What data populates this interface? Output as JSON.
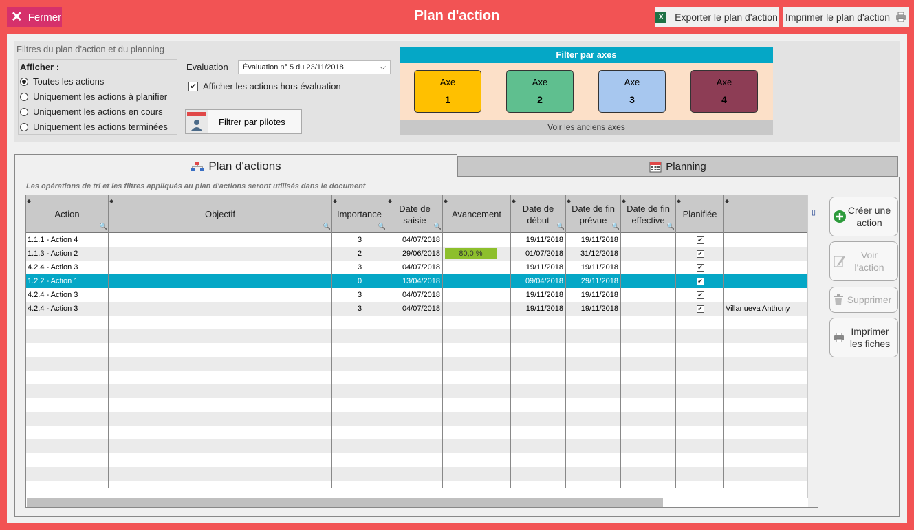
{
  "header": {
    "close_label": "Fermer",
    "title": "Plan d'action",
    "export_label": "Exporter le plan d'action",
    "print_label": "Imprimer le plan d'action"
  },
  "filters": {
    "title": "Filtres du plan d'action et du planning",
    "afficher_label": "Afficher :",
    "options": [
      {
        "label": "Toutes les actions",
        "selected": true
      },
      {
        "label": "Uniquement les actions à planifier",
        "selected": false
      },
      {
        "label": "Uniquement les actions en cours",
        "selected": false
      },
      {
        "label": "Uniquement les actions terminées",
        "selected": false
      }
    ],
    "evaluation_label": "Evaluation",
    "evaluation_value": "Évaluation n° 5 du 23/11/2018",
    "hors_evaluation_label": "Afficher les actions hors évaluation",
    "hors_evaluation_checked": true,
    "pilotes_label": "Filtrer par pilotes"
  },
  "axes": {
    "header": "Filter par axes",
    "footer": "Voir les anciens axes",
    "items": [
      {
        "label": "Axe",
        "number": "1",
        "color": "#ffc000"
      },
      {
        "label": "Axe",
        "number": "2",
        "color": "#5fbf8f"
      },
      {
        "label": "Axe",
        "number": "3",
        "color": "#a7c7ef"
      },
      {
        "label": "Axe",
        "number": "4",
        "color": "#8d3d55"
      }
    ]
  },
  "tabs": {
    "plan": "Plan d'actions",
    "planning": "Planning"
  },
  "note": "Les opérations de tri et les filtres appliqués au plan d'actions seront utilisés dans le document",
  "table": {
    "columns": [
      "Action",
      "Objectif",
      "Importance",
      "Date de saisie",
      "Avancement",
      "Date de début",
      "Date de fin prévue",
      "Date de fin effective",
      "Planifiée",
      ""
    ],
    "rows": [
      {
        "action": "1.1.1 - Action 4",
        "objectif": "",
        "importance": "3",
        "saisie": "04/07/2018",
        "avancement": "",
        "debut": "19/11/2018",
        "fin_prevue": "19/11/2018",
        "fin_effective": "",
        "planifiee": true,
        "pilote": ""
      },
      {
        "action": "1.1.3 - Action 2",
        "objectif": "",
        "importance": "2",
        "saisie": "29/06/2018",
        "avancement": "80,0 %",
        "debut": "01/07/2018",
        "fin_prevue": "31/12/2018",
        "fin_effective": "",
        "planifiee": true,
        "pilote": ""
      },
      {
        "action": "4.2.4 - Action 3",
        "objectif": "",
        "importance": "3",
        "saisie": "04/07/2018",
        "avancement": "",
        "debut": "19/11/2018",
        "fin_prevue": "19/11/2018",
        "fin_effective": "",
        "planifiee": true,
        "pilote": ""
      },
      {
        "action": "1.2.2 - Action 1",
        "objectif": "",
        "importance": "0",
        "saisie": "13/04/2018",
        "avancement": "",
        "debut": "09/04/2018",
        "fin_prevue": "29/11/2018",
        "fin_effective": "",
        "planifiee": true,
        "pilote": ""
      },
      {
        "action": "4.2.4 - Action 3",
        "objectif": "",
        "importance": "3",
        "saisie": "04/07/2018",
        "avancement": "",
        "debut": "19/11/2018",
        "fin_prevue": "19/11/2018",
        "fin_effective": "",
        "planifiee": true,
        "pilote": ""
      },
      {
        "action": "4.2.4 - Action 3",
        "objectif": "",
        "importance": "3",
        "saisie": "04/07/2018",
        "avancement": "",
        "debut": "19/11/2018",
        "fin_prevue": "19/11/2018",
        "fin_effective": "",
        "planifiee": true,
        "pilote": "Villanueva Anthony"
      }
    ],
    "selected_row": 3
  },
  "actions": {
    "create": "Créer une action",
    "view": "Voir l'action",
    "delete": "Supprimer",
    "print": "Imprimer les fiches"
  },
  "colors": {
    "frame": "#f25354",
    "close_button": "#d6316b",
    "accent": "#05a7c6",
    "progress": "#8dbf2c"
  }
}
